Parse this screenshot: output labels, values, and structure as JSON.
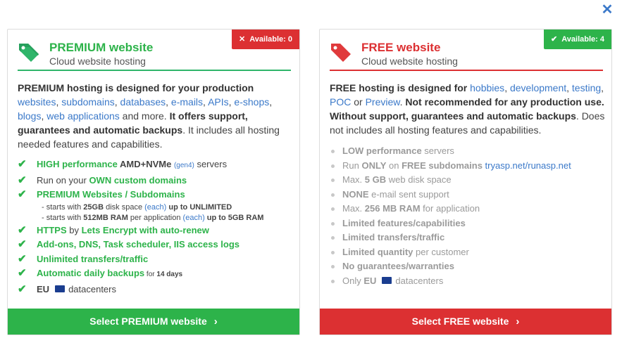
{
  "close_label": "✕",
  "premium": {
    "badge": "Available: 0",
    "badge_icon": "✕",
    "title": "PREMIUM website",
    "subtitle": "Cloud website hosting",
    "desc": {
      "lead": "PREMIUM hosting",
      "p1": " is designed for your production ",
      "links": [
        "websites",
        "subdomains",
        "databases",
        "e-mails",
        "APIs",
        "e-shops",
        "blogs",
        "web applications"
      ],
      "p2": " and more. ",
      "p3": "It offers support, guarantees and automatic backups",
      "p4": ". It includes all hosting needed features and capabilities."
    },
    "features": {
      "f1_a": "HIGH performance",
      "f1_b": " AMD+NVMe ",
      "f1_c": "(gen4)",
      "f1_d": " servers",
      "f2_a": "Run on your ",
      "f2_b": "OWN custom domains",
      "f3": "PREMIUM Websites / Subdomains",
      "f3_s1_a": "- starts with ",
      "f3_s1_b": "25GB",
      "f3_s1_c": " disk space ",
      "f3_s1_d": "(each)",
      "f3_s1_e": " up to UNLIMITED",
      "f3_s2_a": "- starts with ",
      "f3_s2_b": "512MB RAM",
      "f3_s2_c": " per application ",
      "f3_s2_d": "(each)",
      "f3_s2_e": " up to 5GB RAM",
      "f4_a": "HTTPS",
      "f4_b": " by ",
      "f4_c": "Lets Encrypt with auto-renew",
      "f5": "Add-ons, DNS, Task scheduler, IIS access logs",
      "f6": "Unlimited transfers/traffic",
      "f7_a": "Automatic daily backups",
      "f7_b": " for ",
      "f7_c": "14 days",
      "f8_a": "EU",
      "f8_b": "datacenters"
    },
    "check": "✔",
    "button": "Select PREMIUM website",
    "chevron": "›"
  },
  "free": {
    "badge": "Available: 4",
    "badge_icon": "✔",
    "title": "FREE website",
    "subtitle": "Cloud website hosting",
    "desc": {
      "lead": "FREE hosting",
      "p1": " is designed for ",
      "links": [
        "hobbies",
        "development",
        "testing",
        "POC",
        "Preview"
      ],
      "or": " or ",
      "p2": ". ",
      "p3": "Not recommended for any production use. Without support, guarantees and automatic backups",
      "p4": ". Does not includes all hosting features and capabilities."
    },
    "features": {
      "f1_a": "LOW performance",
      "f1_b": " servers",
      "f2_a": "Run ",
      "f2_b": "ONLY",
      "f2_c": " on ",
      "f2_d": "FREE subdomains",
      "f2_e": " tryasp.net/runasp.net",
      "f3_a": "Max. ",
      "f3_b": "5 GB",
      "f3_c": " web disk space",
      "f4_a": "NONE",
      "f4_b": " e-mail sent support",
      "f5_a": "Max. ",
      "f5_b": "256 MB RAM",
      "f5_c": " for application",
      "f6": "Limited features/capabilities",
      "f7": "Limited transfers/traffic",
      "f8_a": "Limited quantity",
      "f8_b": " per customer",
      "f9": "No guarantees/warranties",
      "f10_a": "Only ",
      "f10_b": "EU",
      "f10_c": "datacenters"
    },
    "button": "Select FREE website",
    "chevron": "›"
  },
  "colors": {
    "accent_green": "#2db34a",
    "accent_red": "#dc3032",
    "link": "#3b79c9"
  },
  "icons": [
    "close-icon",
    "tag-icon",
    "check-icon",
    "eu-flag-icon",
    "chevron-right-icon"
  ]
}
